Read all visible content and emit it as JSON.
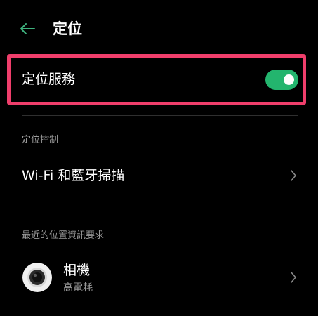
{
  "header": {
    "back_icon": "arrow-left-icon",
    "title": "定位"
  },
  "location_service": {
    "label": "定位服務",
    "enabled": true,
    "toggle_color": "#23b56e",
    "highlight_color": "#ef3e6b"
  },
  "location_control": {
    "section_title": "定位控制",
    "items": [
      {
        "label": "Wi-Fi 和藍牙掃描",
        "icon": "chevron-right-icon"
      }
    ]
  },
  "recent_requests": {
    "section_title": "最近的位置資訊要求",
    "apps": [
      {
        "name": "相機",
        "usage": "高電耗",
        "icon": "camera-app-icon"
      }
    ]
  },
  "colors": {
    "background": "#000000",
    "primary_text": "#ffffff",
    "secondary_text": "#9a9a9a",
    "back_arrow": "#3fb37f"
  }
}
